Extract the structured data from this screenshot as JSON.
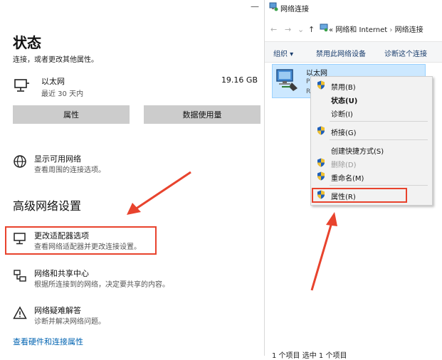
{
  "settings": {
    "title": "状态",
    "subtitle": "连接，或者更改其他属性。",
    "ethernet": {
      "name": "以太网",
      "sub": "最近 30 天内",
      "size": "19.16 GB"
    },
    "buttons": {
      "properties": "属性",
      "data_usage": "数据使用量"
    },
    "show_networks": {
      "title": "显示可用网络",
      "desc": "查看周围的连接选项。"
    },
    "advanced_title": "高级网络设置",
    "adapter": {
      "title": "更改适配器选项",
      "desc": "查看网络适配器并更改连接设置。"
    },
    "sharing": {
      "title": "网络和共享中心",
      "desc": "根据所连接到的网络，决定要共享的内容。"
    },
    "troubleshoot": {
      "title": "网络疑难解答",
      "desc": "诊断并解决网络问题。"
    },
    "hardware_link": "查看硬件和连接属性",
    "window_min": "—"
  },
  "explorer": {
    "title": "网络连接",
    "nav": {
      "back": "←",
      "forward": "→",
      "down": "⌄",
      "up": "↑"
    },
    "breadcrumb": [
      "«",
      "网络和 Internet",
      "›",
      "网络连接"
    ],
    "toolbar": {
      "organize": "组织 ▾",
      "disable": "禁用此网络设备",
      "diagnose": "诊断这个连接"
    },
    "item": {
      "name": "以太网",
      "frag1": "P",
      "frag2": "R"
    },
    "menu": [
      {
        "label": "禁用(B)",
        "shield": true,
        "style": "normal"
      },
      {
        "label": "状态(U)",
        "shield": false,
        "style": "bold"
      },
      {
        "label": "诊断(I)",
        "shield": false,
        "style": "normal"
      },
      {
        "label": "桥接(G)",
        "shield": true,
        "style": "normal"
      },
      {
        "label": "创建快捷方式(S)",
        "shield": false,
        "style": "normal"
      },
      {
        "label": "删除(D)",
        "shield": true,
        "style": "disabled"
      },
      {
        "label": "重命名(M)",
        "shield": true,
        "style": "normal"
      },
      {
        "label": "属性(R)",
        "shield": true,
        "style": "normal"
      }
    ],
    "status": "1 个项目    选中 1 个项目"
  },
  "colors": {
    "highlight_red": "#e8432d",
    "selection_blue": "#cce8ff",
    "link_blue": "#0063b1"
  }
}
